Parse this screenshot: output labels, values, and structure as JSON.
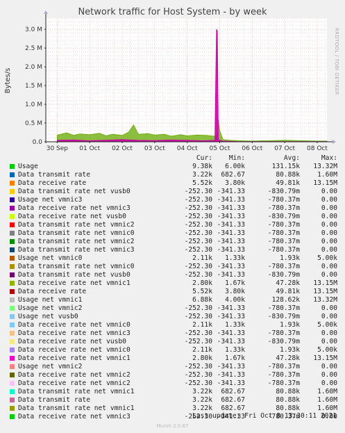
{
  "title": "Network traffic for Host System - by week",
  "side_label": "RRDTOOL / TOBI OETIKER",
  "footer": "Last update: Fri Oct  8 13:30:11 2021",
  "munin": "Munin 2.0.67",
  "headers": {
    "cur": "Cur:",
    "min": "Min:",
    "avg": "Avg:",
    "max": "Max:"
  },
  "chart_data": {
    "type": "area",
    "title": "Network traffic for Host System - by week",
    "ylabel": "Bytes/s",
    "ylim": [
      0,
      3300000
    ],
    "yticks": [
      {
        "value": 0,
        "label": "0.0"
      },
      {
        "value": 500000,
        "label": "0.5 M"
      },
      {
        "value": 1000000,
        "label": "1.0 M"
      },
      {
        "value": 1500000,
        "label": "1.5 M"
      },
      {
        "value": 2000000,
        "label": "2.0 M"
      },
      {
        "value": 2500000,
        "label": "2.5 M"
      },
      {
        "value": 3000000,
        "label": "3.0 M"
      }
    ],
    "xlabels": [
      "30 Sep",
      "01 Oct",
      "02 Oct",
      "03 Oct",
      "04 Oct",
      "05 Oct",
      "06 Oct",
      "07 Oct",
      "08 Oct"
    ],
    "grid": true,
    "series": [
      {
        "name": "Data receive rate",
        "color": "#66aa00",
        "x": [
          0,
          0.3,
          0.5,
          0.7,
          1.0,
          1.3,
          1.5,
          1.7,
          2.0,
          2.2,
          2.35,
          2.5,
          2.8,
          3.0,
          3.3,
          3.5,
          3.8,
          4.0,
          4.3,
          4.6,
          4.8,
          4.9,
          4.93,
          4.96,
          5.0,
          5.1,
          5.3,
          5.6,
          6.0,
          7.0,
          7.5,
          8.0,
          8.3
        ],
        "y": [
          180000,
          240000,
          170000,
          210000,
          190000,
          230000,
          160000,
          200000,
          170000,
          260000,
          450000,
          200000,
          220000,
          180000,
          200000,
          150000,
          190000,
          160000,
          180000,
          170000,
          150000,
          160000,
          250000,
          600000,
          300000,
          60000,
          40000,
          30000,
          20000,
          40000,
          30000,
          20000,
          20000
        ]
      },
      {
        "name": "Data transmit rate",
        "color": "#cc00aa",
        "x": [
          0,
          0.5,
          1.0,
          1.5,
          2.0,
          2.5,
          3.0,
          3.5,
          4.0,
          4.5,
          4.85,
          4.9,
          4.93,
          4.96,
          5.0,
          5.1,
          5.5,
          6.0,
          7.0,
          8.0,
          8.3
        ],
        "y": [
          40000,
          50000,
          30000,
          45000,
          60000,
          40000,
          35000,
          50000,
          40000,
          30000,
          40000,
          3000000,
          2950000,
          60000,
          40000,
          20000,
          10000,
          5000,
          5000,
          5000,
          5000
        ]
      }
    ]
  },
  "legend": [
    {
      "label": "Usage",
      "color": "#00cc00",
      "cur": "9.38k",
      "min": "6.00k",
      "avg": "131.15k",
      "max": "13.32M"
    },
    {
      "label": "Data transmit rate",
      "color": "#0066b3",
      "cur": "3.22k",
      "min": "682.67",
      "avg": "80.88k",
      "max": "1.60M"
    },
    {
      "label": "Data receive rate",
      "color": "#ff8000",
      "cur": "5.52k",
      "min": "3.80k",
      "avg": "49.81k",
      "max": "13.15M"
    },
    {
      "label": "Data transmit rate net vusb0",
      "color": "#ffcc00",
      "cur": "-252.30",
      "min": "-341.33",
      "avg": "-830.79m",
      "max": "0.00"
    },
    {
      "label": "Usage net vmnic3",
      "color": "#330099",
      "cur": "-252.30",
      "min": "-341.33",
      "avg": "-780.37m",
      "max": "0.00"
    },
    {
      "label": "Data receive rate net vmnic3",
      "color": "#990099",
      "cur": "-252.30",
      "min": "-341.33",
      "avg": "-780.37m",
      "max": "0.00"
    },
    {
      "label": "Data receive rate net vusb0",
      "color": "#ccff00",
      "cur": "-252.30",
      "min": "-341.33",
      "avg": "-830.79m",
      "max": "0.00"
    },
    {
      "label": "Data transmit rate net vmnic2",
      "color": "#ff0000",
      "cur": "-252.30",
      "min": "-341.33",
      "avg": "-780.37m",
      "max": "0.00"
    },
    {
      "label": "Data transmit rate net vmnic0",
      "color": "#808080",
      "cur": "-252.30",
      "min": "-341.33",
      "avg": "-780.37m",
      "max": "0.00"
    },
    {
      "label": "Data transmit rate net vmnic2",
      "color": "#008f00",
      "cur": "-252.30",
      "min": "-341.33",
      "avg": "-780.37m",
      "max": "0.00"
    },
    {
      "label": "Data transmit rate net vmnic3",
      "color": "#00487d",
      "cur": "-252.30",
      "min": "-341.33",
      "avg": "-780.37m",
      "max": "0.00"
    },
    {
      "label": "Usage net vmnic0",
      "color": "#b35a00",
      "cur": "2.11k",
      "min": "1.33k",
      "avg": "1.93k",
      "max": "5.00k"
    },
    {
      "label": "Data transmit rate net vmnic0",
      "color": "#b38f00",
      "cur": "-252.30",
      "min": "-341.33",
      "avg": "-780.37m",
      "max": "0.00"
    },
    {
      "label": "Data transmit rate net vusb0",
      "color": "#6b006b",
      "cur": "-252.30",
      "min": "-341.33",
      "avg": "-830.79m",
      "max": "0.00"
    },
    {
      "label": "Data receive rate net vmnic1",
      "color": "#8fb300",
      "cur": "2.80k",
      "min": "1.67k",
      "avg": "47.28k",
      "max": "13.15M"
    },
    {
      "label": "Data receive rate",
      "color": "#b30000",
      "cur": "5.52k",
      "min": "3.80k",
      "avg": "49.81k",
      "max": "13.15M"
    },
    {
      "label": "Usage net vmnic1",
      "color": "#bebebe",
      "cur": "6.88k",
      "min": "4.00k",
      "avg": "128.62k",
      "max": "13.32M"
    },
    {
      "label": "Usage net vmnic2",
      "color": "#80ff80",
      "cur": "-252.30",
      "min": "-341.33",
      "avg": "-780.37m",
      "max": "0.00"
    },
    {
      "label": "Usage net vusb0",
      "color": "#80c9ff",
      "cur": "-252.30",
      "min": "-341.33",
      "avg": "-830.79m",
      "max": "0.00"
    },
    {
      "label": "Data receive rate net vmnic0",
      "color": "#80c9ff",
      "cur": "2.11k",
      "min": "1.33k",
      "avg": "1.93k",
      "max": "5.00k"
    },
    {
      "label": "Data receive rate net vmnic3",
      "color": "#ffc080",
      "cur": "-252.30",
      "min": "-341.33",
      "avg": "-780.37m",
      "max": "0.00"
    },
    {
      "label": "Data receive rate net vusb0",
      "color": "#ffe680",
      "cur": "-252.30",
      "min": "-341.33",
      "avg": "-830.79m",
      "max": "0.00"
    },
    {
      "label": "Data receive rate net vmnic0",
      "color": "#aa80ff",
      "cur": "2.11k",
      "min": "1.33k",
      "avg": "1.93k",
      "max": "5.00k"
    },
    {
      "label": "Data receive rate net vmnic1",
      "color": "#ee00cc",
      "cur": "2.80k",
      "min": "1.67k",
      "avg": "47.28k",
      "max": "13.15M"
    },
    {
      "label": "Usage net vmnic2",
      "color": "#ff8080",
      "cur": "-252.30",
      "min": "-341.33",
      "avg": "-780.37m",
      "max": "0.00"
    },
    {
      "label": "Data receive rate net vmnic2",
      "color": "#666600",
      "cur": "-252.30",
      "min": "-341.33",
      "avg": "-780.37m",
      "max": "0.00"
    },
    {
      "label": "Data receive rate net vmnic2",
      "color": "#ffbfff",
      "cur": "-252.30",
      "min": "-341.33",
      "avg": "-780.37m",
      "max": "0.00"
    },
    {
      "label": "Data transmit rate net vmnic1",
      "color": "#00ffcc",
      "cur": "3.22k",
      "min": "682.67",
      "avg": "80.88k",
      "max": "1.60M"
    },
    {
      "label": "Data transmit rate",
      "color": "#cc6699",
      "cur": "3.22k",
      "min": "682.67",
      "avg": "80.88k",
      "max": "1.60M"
    },
    {
      "label": "Data transmit rate net vmnic1",
      "color": "#999900",
      "cur": "3.22k",
      "min": "682.67",
      "avg": "80.88k",
      "max": "1.60M"
    },
    {
      "label": "Data receive rate net vmnic3",
      "color": "#00cc00",
      "cur": "-252.30",
      "min": "-341.33",
      "avg": "-780.37m",
      "max": "0.00"
    }
  ]
}
